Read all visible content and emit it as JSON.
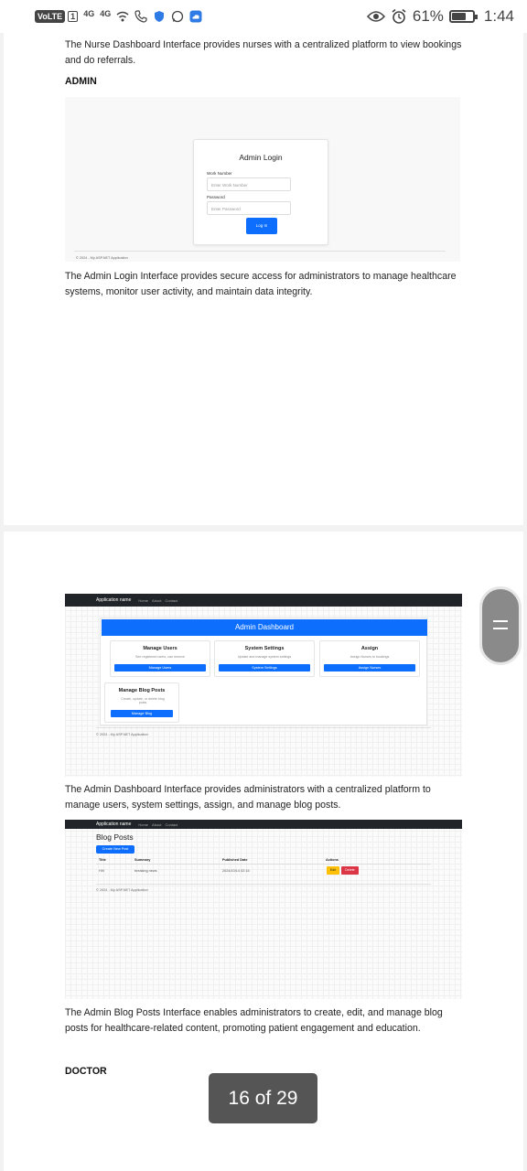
{
  "status_bar": {
    "volte": "VoLTE",
    "sim": "1",
    "signal1": "4G",
    "signal2": "4G",
    "battery_percent": "61%",
    "battery_level": 0.61,
    "time": "1:44"
  },
  "page1": {
    "nurse_text": "The Nurse Dashboard Interface provides nurses with a centralized platform to view bookings and do referrals.",
    "admin_heading": "ADMIN",
    "admin_login_shot": {
      "title": "Admin Login",
      "work_number_label": "Work Number",
      "work_number_placeholder": "Enter Work Number",
      "password_label": "Password",
      "password_placeholder": "Enter Password",
      "login_button": "Log In",
      "footer": "© 2024 - My ASP.NET Application"
    },
    "admin_login_text": "The Admin Login Interface provides secure access for administrators to manage healthcare systems, monitor user activity, and maintain data integrity."
  },
  "page2": {
    "dashboard_shot": {
      "nav_brand": "Application name",
      "nav_links": [
        "Home",
        "About",
        "Contact"
      ],
      "header": "Admin Dashboard",
      "cards": [
        {
          "title": "Manage Users",
          "subtitle": "See registered users, can remove",
          "button": "Manage Users"
        },
        {
          "title": "System Settings",
          "subtitle": "Update and manage system settings",
          "button": "System Settings"
        },
        {
          "title": "Assign",
          "subtitle": "Assign Nurses to bookings",
          "button": "Assign Nurses"
        },
        {
          "title": "Manage Blog Posts",
          "subtitle": "Create, update, or delete blog posts",
          "button": "Manage Blog"
        }
      ],
      "footer": "© 2024 - My ASP.NET Application"
    },
    "dashboard_text": "The Admin Dashboard Interface provides administrators with a centralized platform to manage users, system settings, assign, and manage blog posts.",
    "blog_shot": {
      "nav_brand": "Application name",
      "nav_links": [
        "Home",
        "About",
        "Contact"
      ],
      "title": "Blog Posts",
      "create_button": "Create New Post",
      "columns": [
        "Title",
        "Summary",
        "Published Date",
        "Actions"
      ],
      "row": {
        "title": "HIV",
        "summary": "breaking news",
        "date": "2024/10/14 02:16",
        "edit": "Edit",
        "delete": "Delete"
      },
      "footer": "© 2024 - My ASP.NET Application"
    },
    "blog_text": "The Admin Blog Posts Interface enables administrators to create, edit, and manage blog posts for healthcare-related content, promoting patient engagement and education.",
    "doctor_heading": "DOCTOR"
  },
  "page_counter": "16 of 29"
}
